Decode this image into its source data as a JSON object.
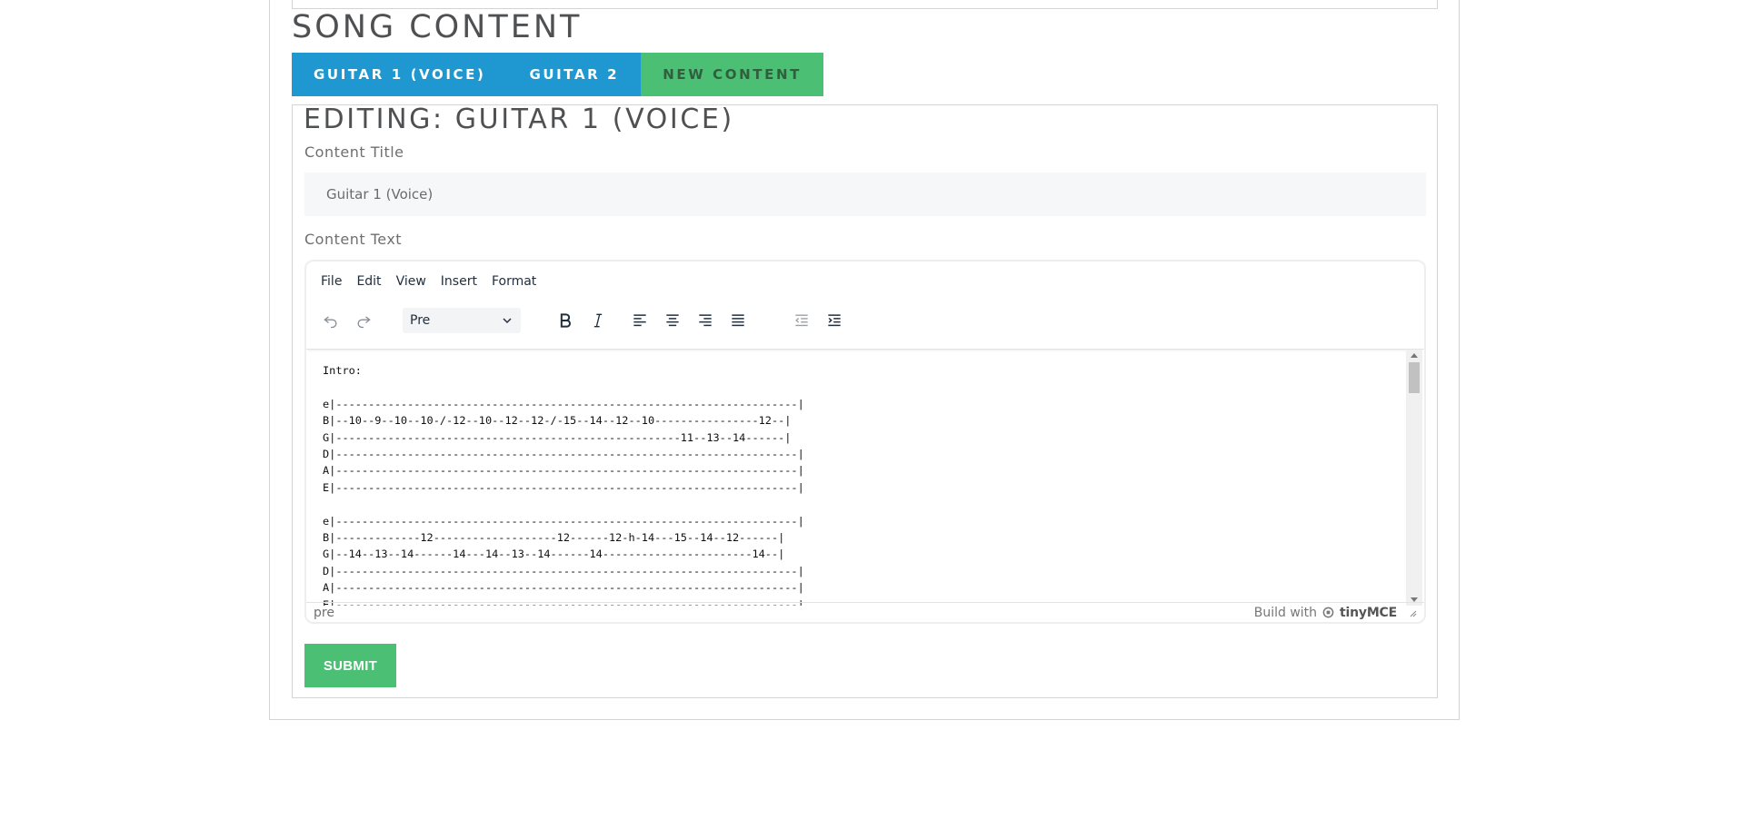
{
  "page": {
    "section_title": "SONG CONTENT"
  },
  "tabs": [
    {
      "label": "GUITAR 1 (VOICE)",
      "color": "#1f98d1"
    },
    {
      "label": "GUITAR 2",
      "color": "#1f98d1"
    },
    {
      "label": "NEW CONTENT",
      "color": "#4bbf73"
    }
  ],
  "editor_form": {
    "heading": "EDITING: GUITAR 1 (VOICE)",
    "content_title_label": "Content Title",
    "content_title_value": "Guitar 1 (Voice)",
    "content_text_label": "Content Text",
    "submit_label": "SUBMIT"
  },
  "tinymce": {
    "menubar": [
      "File",
      "Edit",
      "View",
      "Insert",
      "Format"
    ],
    "toolbar": {
      "icons": [
        "undo-icon",
        "redo-icon",
        "bold-icon",
        "italic-icon",
        "align-left-icon",
        "align-center-icon",
        "align-right-icon",
        "align-justify-icon",
        "outdent-icon",
        "indent-icon"
      ],
      "block_format": "Pre"
    },
    "content": "Intro:\n\ne|-----------------------------------------------------------------------|\nB|--10--9--10--10-/-12--10--12--12-/-15--14--12--10----------------12--|\nG|-----------------------------------------------------11--13--14------|\nD|-----------------------------------------------------------------------|\nA|-----------------------------------------------------------------------|\nE|-----------------------------------------------------------------------|\n\ne|-----------------------------------------------------------------------|\nB|-------------12-------------------12------12-h-14---15--14--12------|\nG|--14--13--14------14---14--13--14------14-----------------------14--|\nD|-----------------------------------------------------------------------|\nA|-----------------------------------------------------------------------|\nE|-----------------------------------------------------------------------|",
    "status_path": "pre",
    "branding_prefix": "Build with",
    "branding_name": "tinyMCE"
  },
  "colors": {
    "accent_blue": "#1f98d1",
    "accent_green": "#4bbf73",
    "heading_gray": "#4f5052"
  }
}
